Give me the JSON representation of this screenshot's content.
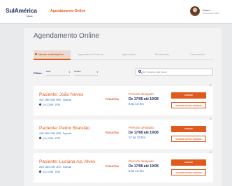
{
  "header": {
    "logo_main": "SulAmérica",
    "logo_sub": "Saúde",
    "app_title": "Agendamento Online",
    "user_name": "Karen",
    "user_clinic": "Clinica Bem Estar"
  },
  "page": {
    "title": "Agendamento Online"
  },
  "tabs": [
    {
      "label": "Novas solicitações",
      "active": true
    },
    {
      "label": "Aguardando Retorno"
    },
    {
      "label": "Agendadas"
    },
    {
      "label": "Finalizadas"
    },
    {
      "label": "Canceladas"
    }
  ],
  "filters": {
    "label": "Filtrar:",
    "date_select": "Data",
    "time_select": "Horário",
    "search_placeholder": "Ex: Paciente João Neves"
  },
  "cards": [
    {
      "patient": "Paciente: João Neves",
      "patient_id": "4827 4589 3468 9959 - Especial",
      "phone": "(11) 12398 - 8798",
      "specialty": "PEDIATRIA",
      "period_label": "Período desejado",
      "period_range": "De 17/08 até 19/08",
      "period_time": "8 às 10 hrs",
      "primary_button": "ENVIAR",
      "secondary_button": "SUGERIR OUTRO HORÁRIO"
    },
    {
      "patient": "Paciente: Pedro Brandão",
      "patient_id": "4282 2839 2038 2838 - Especial",
      "phone": "(11) 12398 - 8798",
      "specialty": "PEDIATRIA",
      "period_label": "Período desejado",
      "period_range": "De 17/08 até 19/08",
      "period_time": "17 às 19 hrs",
      "primary_button": "ENVIAR",
      "secondary_button": "SUGERIR OUTRO HORÁRIO"
    },
    {
      "patient": "Paciente: Luciana Ap. Alves",
      "patient_id": "2820 2839 2939 2192 - Especial",
      "phone": "(11) 12398 - 8798",
      "specialty": "PEDIATRIA",
      "period_label": "Período desejado",
      "period_range": "De 17/08 até 19/08",
      "period_time": "8 às 10 hrs",
      "primary_button": "ENVIAR",
      "secondary_button": "SUGERIR OUTRO HORÁRIO"
    }
  ],
  "icons": {
    "close": "close-icon",
    "phone": "phone-icon",
    "search": "search-icon",
    "chevron": "chevron-down-icon",
    "alert": "alert-dot-icon"
  },
  "colors": {
    "accent": "#e05a1e",
    "navy": "#1d2f63",
    "link_blue": "#2f6fbf",
    "background": "#e9eaec"
  }
}
